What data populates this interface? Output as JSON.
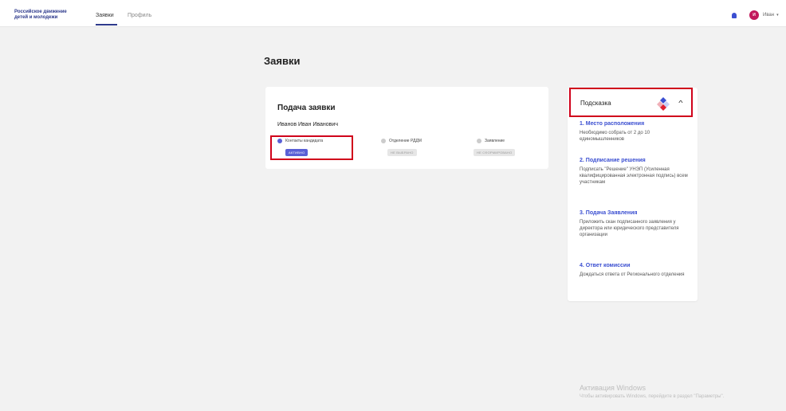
{
  "header": {
    "logo_line1": "Российское движение",
    "logo_line2": "детей и молодежи",
    "tabs": [
      {
        "label": "Заявки",
        "active": true
      },
      {
        "label": "Профиль",
        "active": false
      }
    ],
    "user": {
      "initial": "И",
      "name": "Иван",
      "avatar_color": "#c2185b"
    },
    "accent_color": "#2e3a8c"
  },
  "page_title": "Заявки",
  "application": {
    "title": "Подача заявки",
    "applicant": "Иванов Иван Иванович",
    "steps": [
      {
        "label": "Контакты кандидата",
        "status": "АКТИВНО",
        "active": true
      },
      {
        "label": "Отделение РДДМ",
        "status": "НЕ ВЫБРАНО",
        "active": false
      },
      {
        "label": "Заявление",
        "status": "НЕ СФОРМИРОВАНО",
        "active": false
      }
    ]
  },
  "hint": {
    "title": "Подсказка",
    "items": [
      {
        "title": "1. Место расположения",
        "text": "Необходимо собрать от 2 до 10 единомышленников"
      },
      {
        "title": "2. Подписание решения",
        "text": "Подписать \"Решение\" УНЭП (Усиленная квалифицированная электронная подпись) всем участникам"
      },
      {
        "title": "3. Подача Заявления",
        "text": "Приложить скан подписанного заявления у директора или юридического представителя организации"
      },
      {
        "title": "4. Ответ комиссии",
        "text": "Дождаться ответа от Регионального отделения"
      }
    ]
  },
  "watermark": {
    "title": "Активация Windows",
    "subtitle": "Чтобы активировать Windows, перейдите в раздел \"Параметры\"."
  }
}
